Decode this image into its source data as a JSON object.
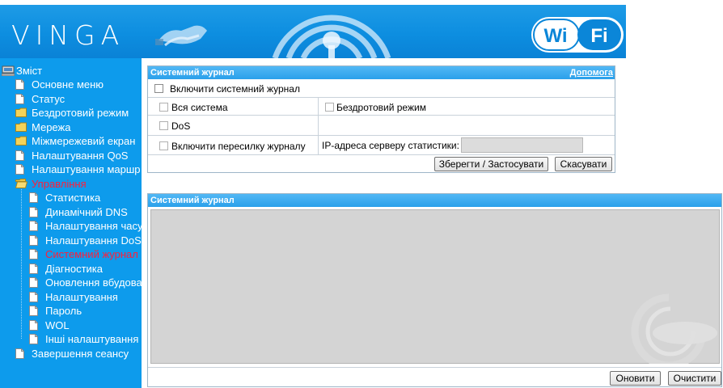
{
  "header": {
    "logo_text": "VINGA",
    "wifi_badge": {
      "left": "Wi",
      "right": "Fi"
    },
    "banner_color": "#0d8ee0"
  },
  "sidebar": {
    "background": "#0d9bec",
    "root": {
      "label": "Зміст",
      "icon": "computer-icon"
    },
    "items": [
      {
        "label": "Основне меню",
        "icon": "page-icon"
      },
      {
        "label": "Статус",
        "icon": "page-icon"
      },
      {
        "label": "Бездротовий режим",
        "icon": "folder-icon"
      },
      {
        "label": "Мережа",
        "icon": "folder-icon"
      },
      {
        "label": "Міжмережевий екран",
        "icon": "folder-icon"
      },
      {
        "label": "Налаштування QoS",
        "icon": "page-icon"
      },
      {
        "label": "Налаштування маршр",
        "icon": "page-icon"
      },
      {
        "label": "Управління",
        "icon": "open-folder-icon",
        "active": true
      },
      {
        "label": "Статистика",
        "icon": "page-icon"
      },
      {
        "label": "Динамічний DNS",
        "icon": "page-icon"
      },
      {
        "label": "Налаштування часу",
        "icon": "page-icon"
      },
      {
        "label": "Налаштування DoS",
        "icon": "page-icon"
      },
      {
        "label": "Системний журнал",
        "icon": "page-icon",
        "active": true
      },
      {
        "label": "Діагностика",
        "icon": "page-icon"
      },
      {
        "label": "Оновлення вбудова",
        "icon": "page-icon"
      },
      {
        "label": "Налаштування",
        "icon": "page-icon"
      },
      {
        "label": "Пароль",
        "icon": "page-icon"
      },
      {
        "label": "WOL",
        "icon": "page-icon"
      },
      {
        "label": "Інші налаштування",
        "icon": "page-icon"
      },
      {
        "label": "Завершення сеансу",
        "icon": "page-icon"
      }
    ]
  },
  "settings_panel": {
    "title": "Системний журнал",
    "help_label": "Допомога",
    "enable_log": {
      "label": "Включити системний журнал",
      "checked": false
    },
    "all_system": {
      "label": "Вся система",
      "checked": false
    },
    "wireless": {
      "label": "Бездротовий режим",
      "checked": false
    },
    "dos": {
      "label": "DoS",
      "checked": false
    },
    "remote_forward": {
      "label": "Включити пересилку журналу",
      "checked": false
    },
    "ip_label": "IP-адреса серверу статистики:",
    "ip_value": "",
    "save_button": "Зберегти / Застосувати",
    "cancel_button": "Скасувати"
  },
  "log_panel": {
    "title": "Системний журнал",
    "log_text": "",
    "refresh_button": "Оновити",
    "clear_button": "Очистити"
  },
  "colors": {
    "accent": "#2aa0ea",
    "active_nav": "#ff1e3a",
    "log_bg": "#d4d4d4"
  }
}
